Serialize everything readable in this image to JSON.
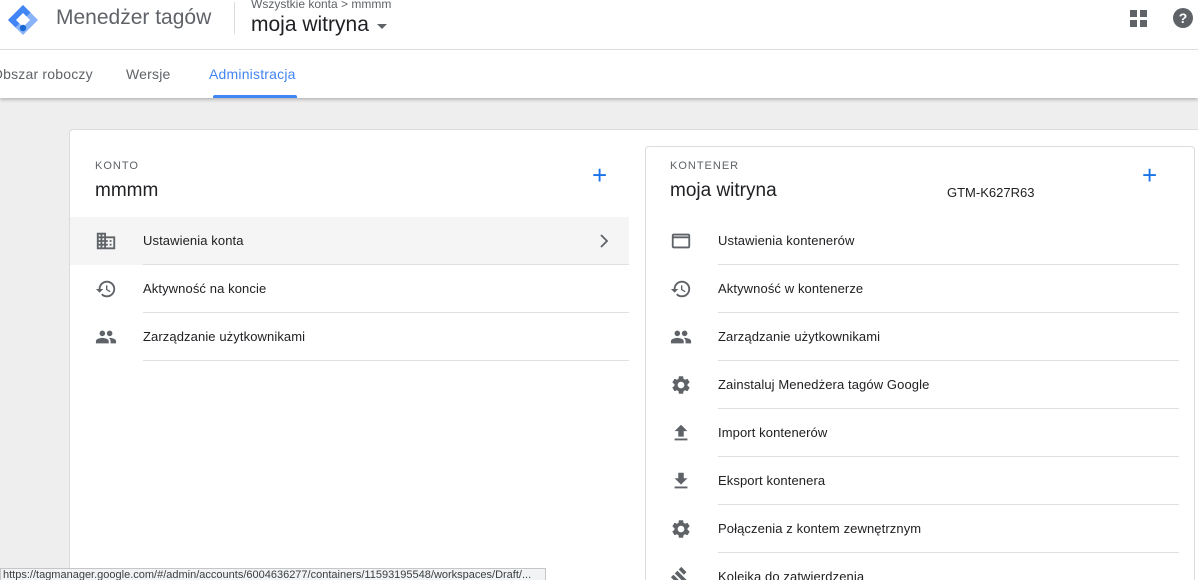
{
  "header": {
    "app_name": "Menedżer tagów",
    "breadcrumb": "Wszystkie konta > mmmm",
    "container_name": "moja witryna"
  },
  "tabs": [
    {
      "label": "Obszar roboczy"
    },
    {
      "label": "Wersje"
    },
    {
      "label": "Administracja"
    }
  ],
  "account": {
    "label": "KONTO",
    "name": "mmmm",
    "items": [
      {
        "label": "Ustawienia konta",
        "icon": "building-icon"
      },
      {
        "label": "Aktywność na koncie",
        "icon": "history-icon"
      },
      {
        "label": "Zarządzanie użytkownikami",
        "icon": "people-icon"
      }
    ]
  },
  "container": {
    "label": "KONTENER",
    "name": "moja witryna",
    "id": "GTM-K627R63",
    "items": [
      {
        "label": "Ustawienia kontenerów",
        "icon": "window-icon"
      },
      {
        "label": "Aktywność w kontenerze",
        "icon": "history-icon"
      },
      {
        "label": "Zarządzanie użytkownikami",
        "icon": "people-icon"
      },
      {
        "label": "Zainstaluj Menedżera tagów Google",
        "icon": "gear-icon"
      },
      {
        "label": "Import kontenerów",
        "icon": "upload-icon"
      },
      {
        "label": "Eksport kontenera",
        "icon": "download-icon"
      },
      {
        "label": "Połączenia z kontem zewnętrznym",
        "icon": "gear-icon"
      },
      {
        "label": "Kolejka do zatwierdzenia",
        "icon": "gavel-icon"
      }
    ]
  },
  "status_bar": {
    "url": "https://tagmanager.google.com/#/admin/accounts/6004636277/containers/11593195548/workspaces/Draft/..."
  },
  "colors": {
    "accent": "#4285f4",
    "plus": "#1a73e8"
  }
}
